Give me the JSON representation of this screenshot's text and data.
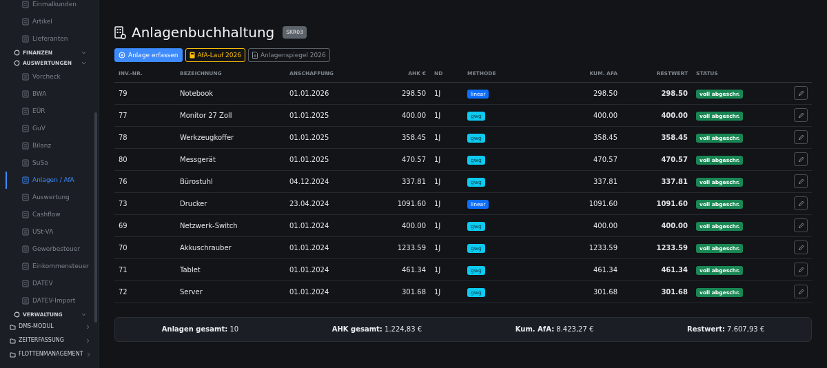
{
  "sidebar": {
    "items": [
      {
        "kind": "item",
        "label": "Einmalkunden",
        "selected": false
      },
      {
        "kind": "item",
        "label": "Artikel",
        "selected": false
      },
      {
        "kind": "item",
        "label": "Lieferanten",
        "selected": false
      },
      {
        "kind": "section",
        "label": "FINANZEN",
        "expanded": true
      },
      {
        "kind": "section",
        "label": "AUSWERTUNGEN",
        "expanded": true
      },
      {
        "kind": "item",
        "label": "Vorcheck",
        "selected": false
      },
      {
        "kind": "item",
        "label": "BWA",
        "selected": false
      },
      {
        "kind": "item",
        "label": "EÜR",
        "selected": false
      },
      {
        "kind": "item",
        "label": "GuV",
        "selected": false
      },
      {
        "kind": "item",
        "label": "Bilanz",
        "selected": false
      },
      {
        "kind": "item",
        "label": "SuSa",
        "selected": false
      },
      {
        "kind": "item",
        "label": "Anlagen / AfA",
        "selected": true
      },
      {
        "kind": "item",
        "label": "Auswertung",
        "selected": false
      },
      {
        "kind": "item",
        "label": "Cashflow",
        "selected": false
      },
      {
        "kind": "item",
        "label": "USt-VA",
        "selected": false
      },
      {
        "kind": "item",
        "label": "Gewerbesteuer",
        "selected": false
      },
      {
        "kind": "item",
        "label": "Einkommensteuer",
        "selected": false
      },
      {
        "kind": "item",
        "label": "DATEV",
        "selected": false
      },
      {
        "kind": "item",
        "label": "DATEV-Import",
        "selected": false
      },
      {
        "kind": "section",
        "label": "VERWALTUNG",
        "expanded": true
      },
      {
        "kind": "group",
        "label": "DMS-MODUL",
        "expanded": false
      },
      {
        "kind": "group",
        "label": "ZEITERFASSUNG",
        "expanded": false
      },
      {
        "kind": "group",
        "label": "FLOTTENMANAGEMENT",
        "expanded": false
      }
    ]
  },
  "page": {
    "title": "Anlagenbuchhaltung",
    "badge": "SKR03",
    "buttons": [
      {
        "kind": "primary",
        "label": "Anlage erfassen"
      },
      {
        "kind": "warning",
        "label": "AfA-Lauf 2026"
      },
      {
        "kind": "secondary",
        "label": "Anlagenspiegel 2026"
      }
    ]
  },
  "table": {
    "columns": [
      "INV.-NR.",
      "BEZEICHNUNG",
      "ANSCHAFFUNG",
      "AHK €",
      "ND",
      "METHODE",
      "KUM. AFA",
      "RESTWERT",
      "STATUS"
    ],
    "rows": [
      {
        "inv": "79",
        "name": "Notebook",
        "date": "01.01.2026",
        "ahk": "298.50",
        "nd": "1J",
        "method": {
          "label": "linear",
          "color": "#0d6efd"
        },
        "kum": "298.50",
        "rest": "298.50",
        "status": {
          "label": "voll abgeschr.",
          "color": "#198754"
        }
      },
      {
        "inv": "77",
        "name": "Monitor 27 Zoll",
        "date": "01.01.2025",
        "ahk": "400.00",
        "nd": "1J",
        "method": {
          "label": "gwg",
          "color": "#0dcaf0"
        },
        "kum": "400.00",
        "rest": "400.00",
        "status": {
          "label": "voll abgeschr.",
          "color": "#198754"
        }
      },
      {
        "inv": "78",
        "name": "Werkzeugkoffer",
        "date": "01.01.2025",
        "ahk": "358.45",
        "nd": "1J",
        "method": {
          "label": "gwg",
          "color": "#0dcaf0"
        },
        "kum": "358.45",
        "rest": "358.45",
        "status": {
          "label": "voll abgeschr.",
          "color": "#198754"
        }
      },
      {
        "inv": "80",
        "name": "Messgerät",
        "date": "01.01.2025",
        "ahk": "470.57",
        "nd": "1J",
        "method": {
          "label": "gwg",
          "color": "#0dcaf0"
        },
        "kum": "470.57",
        "rest": "470.57",
        "status": {
          "label": "voll abgeschr.",
          "color": "#198754"
        }
      },
      {
        "inv": "76",
        "name": "Bürostuhl",
        "date": "04.12.2024",
        "ahk": "337.81",
        "nd": "1J",
        "method": {
          "label": "gwg",
          "color": "#0dcaf0"
        },
        "kum": "337.81",
        "rest": "337.81",
        "status": {
          "label": "voll abgeschr.",
          "color": "#198754"
        }
      },
      {
        "inv": "73",
        "name": "Drucker",
        "date": "23.04.2024",
        "ahk": "1091.60",
        "nd": "1J",
        "method": {
          "label": "linear",
          "color": "#0d6efd"
        },
        "kum": "1091.60",
        "rest": "1091.60",
        "status": {
          "label": "voll abgeschr.",
          "color": "#198754"
        }
      },
      {
        "inv": "69",
        "name": "Netzwerk-Switch",
        "date": "01.01.2024",
        "ahk": "400.00",
        "nd": "1J",
        "method": {
          "label": "gwg",
          "color": "#0dcaf0"
        },
        "kum": "400.00",
        "rest": "400.00",
        "status": {
          "label": "voll abgeschr.",
          "color": "#198754"
        }
      },
      {
        "inv": "70",
        "name": "Akkuschrauber",
        "date": "01.01.2024",
        "ahk": "1233.59",
        "nd": "1J",
        "method": {
          "label": "gwg",
          "color": "#0dcaf0"
        },
        "kum": "1233.59",
        "rest": "1233.59",
        "status": {
          "label": "voll abgeschr.",
          "color": "#198754"
        }
      },
      {
        "inv": "71",
        "name": "Tablet",
        "date": "01.01.2024",
        "ahk": "461.34",
        "nd": "1J",
        "method": {
          "label": "gwg",
          "color": "#0dcaf0"
        },
        "kum": "461.34",
        "rest": "461.34",
        "status": {
          "label": "voll abgeschr.",
          "color": "#198754"
        }
      },
      {
        "inv": "72",
        "name": "Server",
        "date": "01.01.2024",
        "ahk": "301.68",
        "nd": "1J",
        "method": {
          "label": "gwg",
          "color": "#0dcaf0"
        },
        "kum": "301.68",
        "rest": "301.68",
        "status": {
          "label": "voll abgeschr.",
          "color": "#198754"
        }
      }
    ]
  },
  "summary": [
    {
      "label": "Anlagen gesamt:",
      "value": "10"
    },
    {
      "label": "AHK gesamt:",
      "value": "1.224,83 €"
    },
    {
      "label": "Kum. AfA:",
      "value": "8.423,27 €"
    },
    {
      "label": "Restwert:",
      "value": "7.607,93 €"
    }
  ]
}
